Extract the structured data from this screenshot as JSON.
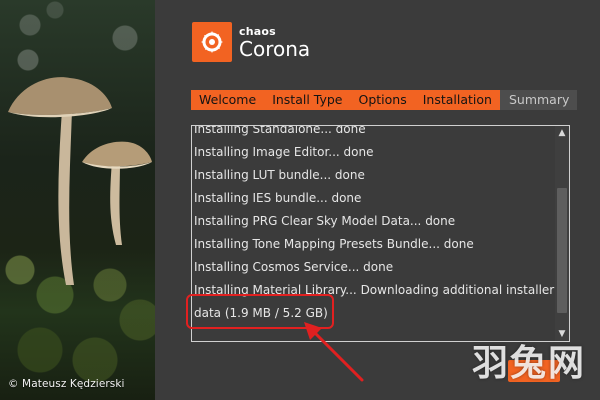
{
  "photo": {
    "credit": "© Mateusz Kędzierski"
  },
  "brand": {
    "maker": "chaos",
    "product": "Corona",
    "accent_color": "#f26322",
    "icon": "corona-swirl-icon"
  },
  "tabs": [
    {
      "label": "Welcome",
      "active": true
    },
    {
      "label": "Install Type",
      "active": true
    },
    {
      "label": "Options",
      "active": true
    },
    {
      "label": "Installation",
      "active": true
    },
    {
      "label": "Summary",
      "active": false
    }
  ],
  "log": {
    "lines": [
      "Installing Standalone... done",
      "Installing Image Editor... done",
      "Installing LUT bundle... done",
      "Installing IES bundle... done",
      "Installing PRG Clear Sky Model Data... done",
      "Installing Tone Mapping Presets Bundle... done",
      "Installing Cosmos Service... done",
      "Installing Material Library... Downloading additional installer",
      "data (1.9 MB / 5.2 GB)"
    ]
  },
  "annotation": {
    "highlight_color": "#e12020"
  },
  "watermark": {
    "text": "羽兔网"
  }
}
